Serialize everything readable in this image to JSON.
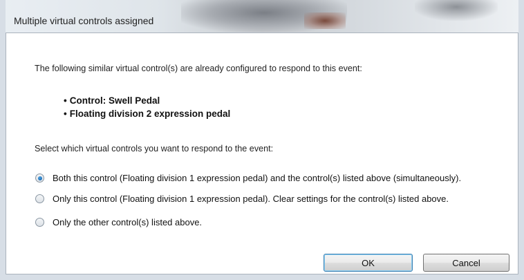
{
  "window": {
    "title": "Multiple virtual controls assigned"
  },
  "dialog": {
    "intro_text": "The following similar virtual control(s) are already configured to respond to this event:",
    "controls": [
      "Control: Swell Pedal",
      "Floating division 2 expression pedal"
    ],
    "select_prompt": "Select which virtual controls you want to respond to the event:",
    "options": [
      {
        "label": "Both this control (Floating division 1 expression pedal) and the control(s) listed above (simultaneously).",
        "checked": true
      },
      {
        "label": "Only this control (Floating division 1 expression pedal). Clear settings for the control(s) listed above.",
        "checked": false
      },
      {
        "label": "Only the other control(s) listed above.",
        "checked": false
      }
    ],
    "ok_label": "OK",
    "cancel_label": "Cancel"
  },
  "colors": {
    "accent": "#1f6fb8",
    "frame": "#d7dee6"
  }
}
